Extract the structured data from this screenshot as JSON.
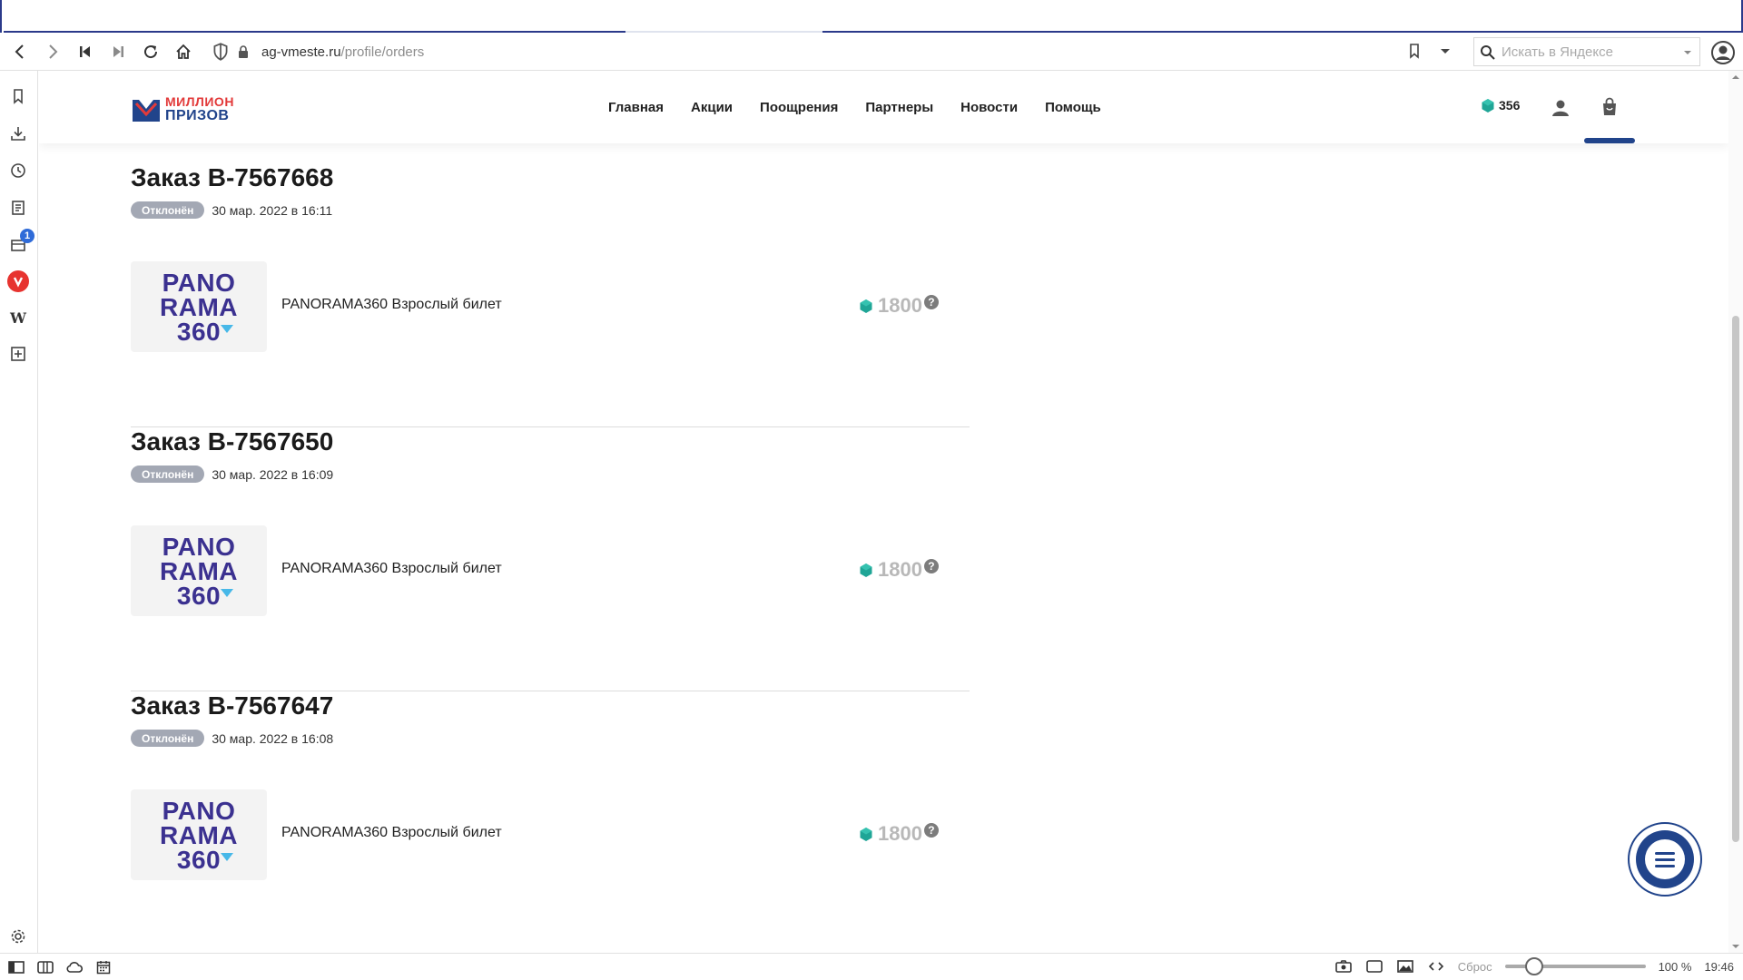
{
  "browser": {
    "url_host": "ag-vmeste.ru",
    "url_path": "/profile/orders",
    "search_placeholder": "Искать в Яндексе",
    "sidebar_badge": "1",
    "wiki_glyph": "W"
  },
  "site": {
    "logo_line1": "МИЛЛИОН",
    "logo_line2": "ПРИЗОВ",
    "nav": [
      "Главная",
      "Акции",
      "Поощрения",
      "Партнеры",
      "Новости",
      "Помощь"
    ],
    "balance": "356"
  },
  "orders": [
    {
      "title": "Заказ B-7567668",
      "status": "Отклонён",
      "date": "30 мар. 2022 в 16:11",
      "product": "PANORAMA360 Взрослый билет",
      "price": "1800"
    },
    {
      "title": "Заказ B-7567650",
      "status": "Отклонён",
      "date": "30 мар. 2022 в 16:09",
      "product": "PANORAMA360 Взрослый билет",
      "price": "1800"
    },
    {
      "title": "Заказ B-7567647",
      "status": "Отклонён",
      "date": "30 мар. 2022 в 16:08",
      "product": "PANORAMA360 Взрослый билет",
      "price": "1800"
    }
  ],
  "product_logo": {
    "line1": "PANO",
    "line2": "RAMA",
    "line3": "360"
  },
  "help_glyph": "?",
  "statusbar": {
    "reset_label": "Сброс",
    "zoom": "100 %",
    "time": "19:46"
  },
  "colors": {
    "brand_blue": "#21448b",
    "brand_red": "#e23a3a",
    "gem_teal": "#1fa596",
    "badge_gray": "#a3a8b4",
    "panorama_purple": "#3b3190"
  }
}
